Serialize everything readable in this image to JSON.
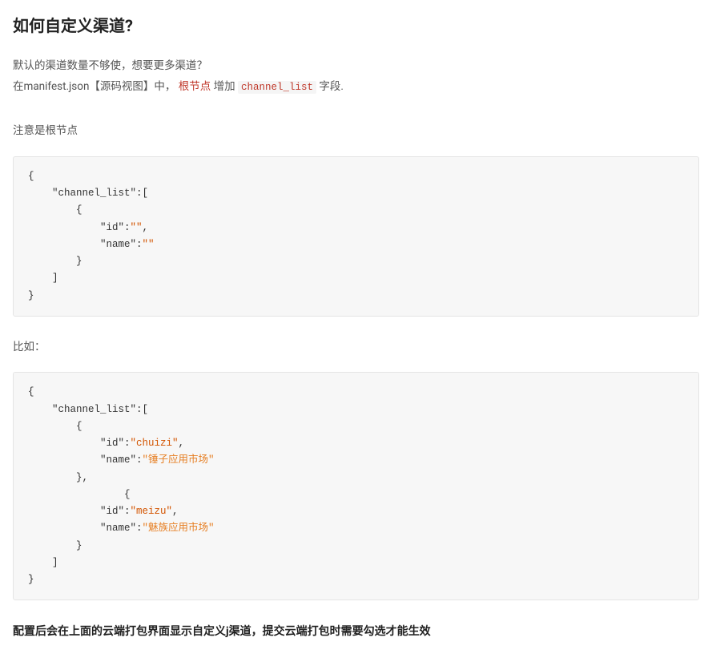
{
  "heading": "如何自定义渠道?",
  "intro": {
    "line1": "默认的渠道数量不够使，想要更多渠道？",
    "line2_prefix": "在manifest.json【源码视图】中，",
    "line2_red": "根节点",
    "line2_mid": " 增加 ",
    "line2_code": "channel_list",
    "line2_suffix": " 字段."
  },
  "note": "注意是根节点",
  "code1": {
    "l1": "{",
    "l2": "    \"channel_list\":[",
    "l3": "        {",
    "l4_a": "            \"id\":",
    "l4_b": "\"\"",
    "l4_c": ",",
    "l5_a": "            \"name\":",
    "l5_b": "\"\"",
    "l6": "        }",
    "l7": "    ]",
    "l8": "}"
  },
  "example_label": "比如：",
  "code2": {
    "l1": "{",
    "l2": "    \"channel_list\":[",
    "l3": "        {",
    "l4_a": "            \"id\":",
    "l4_b": "\"chuizi\"",
    "l4_c": ",",
    "l5_a": "            \"name\":",
    "l5_b": "\"锤子应用市场\"",
    "l6": "        },",
    "l7": "                {",
    "l8_a": "            \"id\":",
    "l8_b": "\"meizu\"",
    "l8_c": ",",
    "l9_a": "            \"name\":",
    "l9_b": "\"魅族应用市场\"",
    "l10": "        }",
    "l11": "    ]",
    "l12": "}"
  },
  "bold_note": "配置后会在上面的云端打包界面显示自定义j渠道，提交云端打包时需要勾选才能生效"
}
